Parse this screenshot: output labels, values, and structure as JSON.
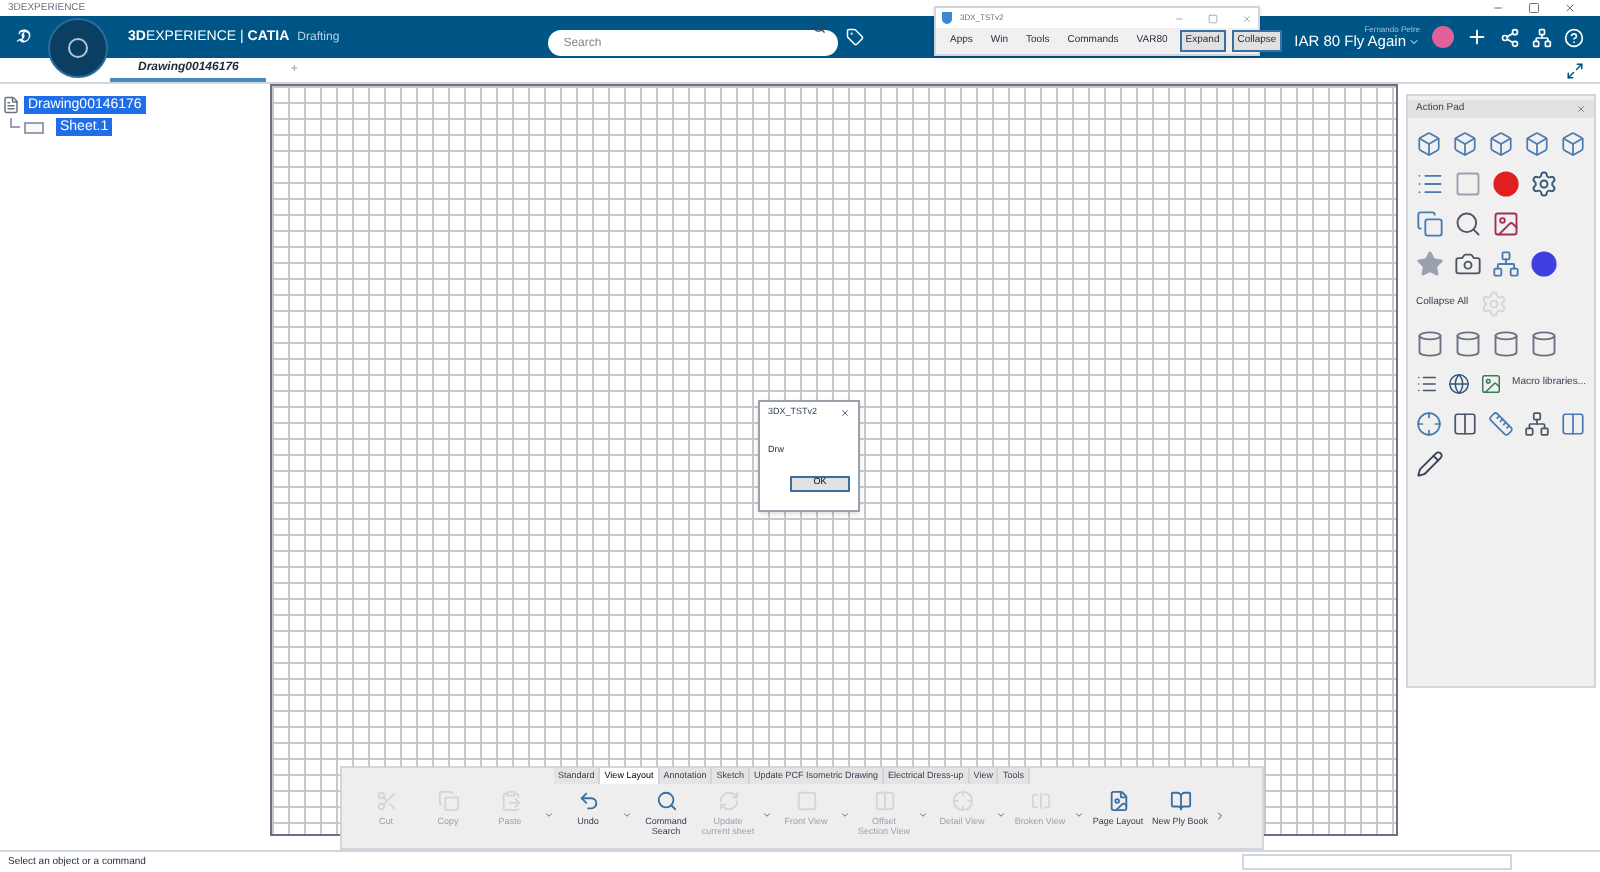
{
  "app_title": "3DEXPERIENCE",
  "brand": {
    "name": "**3D**EXPERIENCE | **CATIA**",
    "app": "Drafting"
  },
  "logo": "𝔇",
  "search": {
    "placeholder": "Search"
  },
  "user": {
    "name": "Fernando Petre",
    "space": "IAR 80 Fly Again"
  },
  "doc_tabs": [
    {
      "label": "Drawing00146176",
      "selected": true
    },
    {
      "label": "+",
      "selected": false
    }
  ],
  "floating_window": {
    "title": "3DX_TSTv2",
    "menu": [
      {
        "label": "Apps",
        "kind": "menu"
      },
      {
        "label": "Win",
        "kind": "menu"
      },
      {
        "label": "Tools",
        "kind": "menu"
      },
      {
        "label": "Commands",
        "kind": "menu"
      },
      {
        "label": "VAR80",
        "kind": "menu"
      },
      {
        "label": "Expand",
        "kind": "button"
      },
      {
        "label": "Collapse",
        "kind": "button"
      }
    ]
  },
  "tree": {
    "label": "Drawing00146176",
    "selected": true,
    "children": [
      {
        "label": "Sheet.1",
        "selected": true
      }
    ]
  },
  "action_pad": {
    "title": "Action Pad",
    "collapse_label": "Collapse All",
    "macro_label": "Macro libraries..."
  },
  "dialog": {
    "title": "3DX_TSTv2",
    "message": "Drw",
    "button": "OK"
  },
  "toolbar": {
    "tabs": [
      {
        "label": "Standard",
        "selected": false
      },
      {
        "label": "View Layout",
        "selected": true
      },
      {
        "label": "Annotation",
        "selected": false
      },
      {
        "label": "Sketch",
        "selected": false
      },
      {
        "label": "Update PCF Isometric Drawing",
        "selected": false
      },
      {
        "label": "Electrical Dress-up",
        "selected": false
      },
      {
        "label": "View",
        "selected": false
      },
      {
        "label": "Tools",
        "selected": false
      }
    ],
    "commands": [
      {
        "label": "Cut",
        "disabled": true,
        "dropdown": false
      },
      {
        "label": "Copy",
        "disabled": true,
        "dropdown": false
      },
      {
        "label": "Paste",
        "disabled": true,
        "dropdown": true
      },
      {
        "label": "Undo",
        "disabled": false,
        "dropdown": true
      },
      {
        "label": "Command Search",
        "disabled": false,
        "dropdown": false
      },
      {
        "label": "Update current sheet",
        "disabled": true,
        "dropdown": true
      },
      {
        "label": "Front View",
        "disabled": true,
        "dropdown": true
      },
      {
        "label": "Offset Section View",
        "disabled": true,
        "dropdown": true
      },
      {
        "label": "Detail View",
        "disabled": true,
        "dropdown": true
      },
      {
        "label": "Broken View",
        "disabled": true,
        "dropdown": true
      },
      {
        "label": "Page Layout",
        "disabled": false,
        "dropdown": false
      },
      {
        "label": "New Ply Book",
        "disabled": false,
        "dropdown": false
      }
    ]
  },
  "status_bar": {
    "text": "Select an object or a command"
  }
}
